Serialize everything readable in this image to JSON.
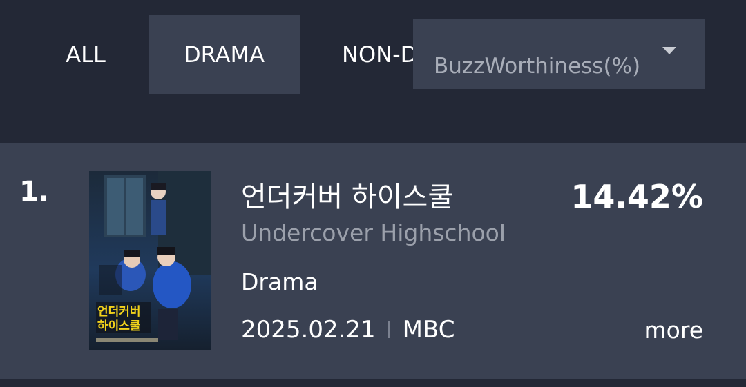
{
  "tabs": [
    {
      "label": "ALL",
      "selected": false
    },
    {
      "label": "DRAMA",
      "selected": true
    },
    {
      "label": "NON-D",
      "selected": false
    }
  ],
  "sort": {
    "selected": "BuzzWorthiness(%)",
    "icon": "chevron-down-icon"
  },
  "items": [
    {
      "rank": "1.",
      "title_ko": "언더커버 하이스쿨",
      "title_en": "Undercover Highschool",
      "score": "14.42%",
      "genre": "Drama",
      "date": "2025.02.21",
      "network": "MBC",
      "more_label": "more",
      "poster_text": [
        "언더커버",
        "하이스쿨"
      ]
    }
  ],
  "colors": {
    "background": "#232836",
    "panel": "#3a4152",
    "muted_text": "#9ba0ab"
  }
}
